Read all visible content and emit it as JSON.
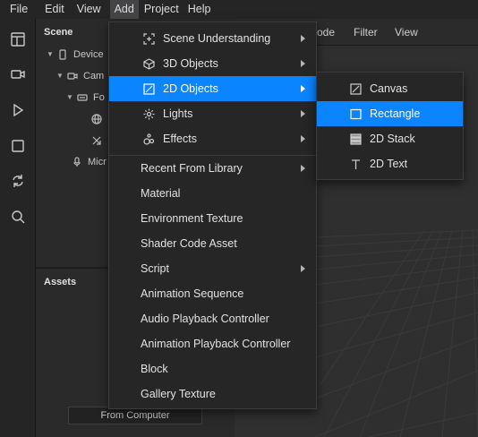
{
  "menubar": {
    "items": [
      {
        "label": "File"
      },
      {
        "label": "Edit"
      },
      {
        "label": "View"
      },
      {
        "label": "Add"
      },
      {
        "label": "Project"
      },
      {
        "label": "Help"
      }
    ],
    "active": "Add"
  },
  "toolbar": {
    "icons": [
      "layout-icon",
      "camera-icon",
      "play-icon",
      "stop-icon",
      "sync-icon",
      "search-icon"
    ]
  },
  "scene": {
    "title": "Scene",
    "tree": [
      {
        "label": "Device",
        "icon": "device-icon"
      },
      {
        "label": "Cam",
        "icon": "camera-icon"
      },
      {
        "label": "Fo",
        "icon": "focal-plane-icon"
      },
      {
        "label": "",
        "icon": "globe-icon"
      },
      {
        "label": "",
        "icon": "resize-icon"
      },
      {
        "label": "Micr",
        "icon": "microphone-icon"
      }
    ]
  },
  "assets": {
    "title": "Assets",
    "from_computer": "From Computer"
  },
  "viewport": {
    "tabs": [
      {
        "label": "ode"
      },
      {
        "label": "Filter"
      },
      {
        "label": "View"
      }
    ]
  },
  "add_menu": {
    "items": [
      {
        "label": "Scene Understanding",
        "icon": "scene-understanding-icon",
        "submenu": true
      },
      {
        "label": "3D Objects",
        "icon": "cube-icon",
        "submenu": true
      },
      {
        "label": "2D Objects",
        "icon": "square-slash-icon",
        "submenu": true,
        "highlighted": true
      },
      {
        "label": "Lights",
        "icon": "light-icon",
        "submenu": true
      },
      {
        "label": "Effects",
        "icon": "effects-icon",
        "submenu": true
      },
      {
        "label": "Recent From Library",
        "submenu": true
      },
      {
        "label": "Material"
      },
      {
        "label": "Environment Texture"
      },
      {
        "label": "Shader Code Asset"
      },
      {
        "label": "Script",
        "submenu": true
      },
      {
        "label": "Animation Sequence"
      },
      {
        "label": "Audio Playback Controller"
      },
      {
        "label": "Animation Playback Controller"
      },
      {
        "label": "Block"
      },
      {
        "label": "Gallery Texture"
      }
    ]
  },
  "submenu_2d": {
    "items": [
      {
        "label": "Canvas",
        "icon": "canvas-icon"
      },
      {
        "label": "Rectangle",
        "icon": "rectangle-icon",
        "highlighted": true
      },
      {
        "label": "2D Stack",
        "icon": "stack-icon"
      },
      {
        "label": "2D Text",
        "icon": "text-icon"
      }
    ]
  },
  "colors": {
    "highlight": "#0a84ff",
    "menu_bg": "#262626",
    "app_bg": "#1e1e1e"
  }
}
